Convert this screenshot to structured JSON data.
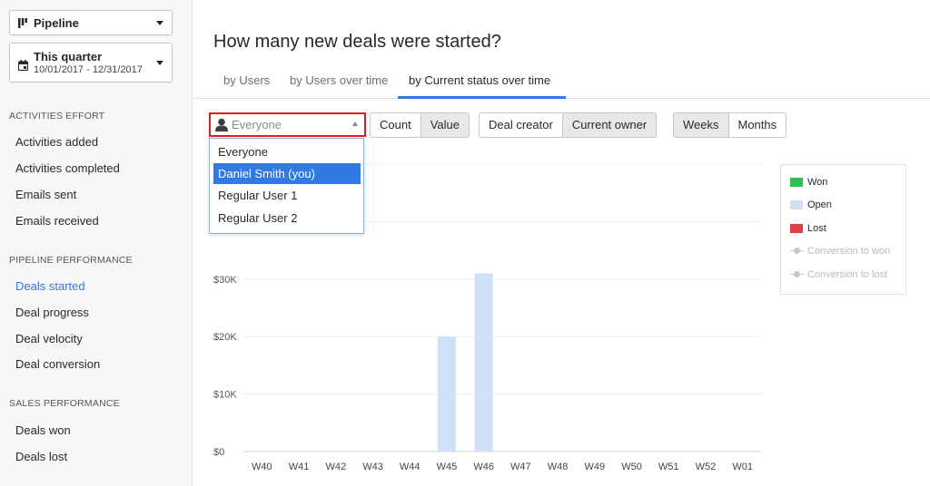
{
  "sidebar": {
    "pipeline_dropdown": {
      "label": "Pipeline"
    },
    "period_dropdown": {
      "label": "This quarter",
      "range": "10/01/2017 - 12/31/2017"
    },
    "sections": [
      {
        "title": "ACTIVITIES EFFORT",
        "items": [
          "Activities added",
          "Activities completed",
          "Emails sent",
          "Emails received"
        ]
      },
      {
        "title": "PIPELINE PERFORMANCE",
        "items": [
          "Deals started",
          "Deal progress",
          "Deal velocity",
          "Deal conversion"
        ]
      },
      {
        "title": "SALES PERFORMANCE",
        "items": [
          "Deals won",
          "Deals lost"
        ]
      }
    ],
    "active_item": "Deals started"
  },
  "main": {
    "title": "How many new deals were started?",
    "tabs": [
      {
        "label": "by Users",
        "active": false
      },
      {
        "label": "by Users over time",
        "active": false
      },
      {
        "label": "by Current status over time",
        "active": true
      }
    ],
    "toolbar": {
      "user_select": {
        "value": "Everyone"
      },
      "measure": [
        {
          "label": "Count",
          "on": false
        },
        {
          "label": "Value",
          "on": true
        }
      ],
      "owner": [
        {
          "label": "Deal creator",
          "on": false
        },
        {
          "label": "Current owner",
          "on": true
        }
      ],
      "interval": [
        {
          "label": "Weeks",
          "on": true
        },
        {
          "label": "Months",
          "on": false
        }
      ]
    },
    "user_list": {
      "options": [
        "Everyone",
        "Daniel Smith (you)",
        "Regular User 1",
        "Regular User 2"
      ],
      "highlighted": "Daniel Smith (you)"
    }
  },
  "legend": {
    "items": [
      {
        "label": "Won",
        "color": "#2fbf52",
        "kind": "swatch",
        "dim": false
      },
      {
        "label": "Open",
        "color": "#cfe0f9",
        "kind": "swatch",
        "dim": false
      },
      {
        "label": "Lost",
        "color": "#e23c45",
        "kind": "swatch",
        "dim": false
      },
      {
        "label": "Conversion to won",
        "color": "#c8c8c8",
        "kind": "line",
        "dim": true
      },
      {
        "label": "Conversion to lost",
        "color": "#c8c8c8",
        "kind": "line",
        "dim": true
      }
    ]
  },
  "chart_data": {
    "type": "bar",
    "categories": [
      "W40",
      "W41",
      "W42",
      "W43",
      "W44",
      "W45",
      "W46",
      "W47",
      "W48",
      "W49",
      "W50",
      "W51",
      "W52",
      "W01"
    ],
    "series": [
      {
        "name": "Won",
        "color": "#2fbf52",
        "values": [
          0,
          0,
          0,
          0,
          0,
          0,
          0,
          0,
          0,
          0,
          0,
          0,
          0,
          0
        ]
      },
      {
        "name": "Open",
        "color": "#cfe0f9",
        "values": [
          0,
          0,
          0,
          0,
          0,
          20000,
          31000,
          0,
          0,
          0,
          0,
          0,
          0,
          0
        ]
      },
      {
        "name": "Lost",
        "color": "#e23c45",
        "values": [
          0,
          0,
          0,
          0,
          0,
          0,
          0,
          0,
          0,
          0,
          0,
          0,
          0,
          0
        ]
      }
    ],
    "yticks": [
      {
        "value": 0,
        "label": "$0"
      },
      {
        "value": 10000,
        "label": "$10K"
      },
      {
        "value": 20000,
        "label": "$20K"
      },
      {
        "value": 30000,
        "label": "$30K"
      }
    ],
    "ylim": [
      0,
      50000
    ],
    "grid": true,
    "legend_position": "right"
  }
}
